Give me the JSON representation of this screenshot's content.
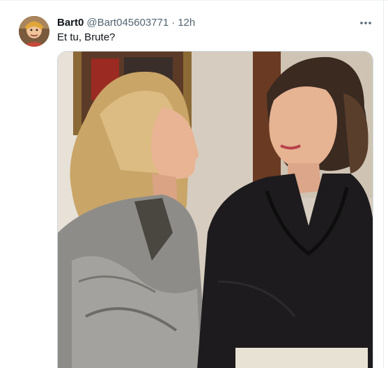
{
  "tweet": {
    "display_name": "Bart0",
    "handle": "@Bart045603771",
    "separator": "·",
    "time": "12h",
    "text": "Et tu, Brute?"
  },
  "icons": {
    "more": "more-horizontal-icon"
  },
  "colors": {
    "primary_text": "#0f1419",
    "secondary_text": "#536471",
    "border": "#cfd9de"
  }
}
